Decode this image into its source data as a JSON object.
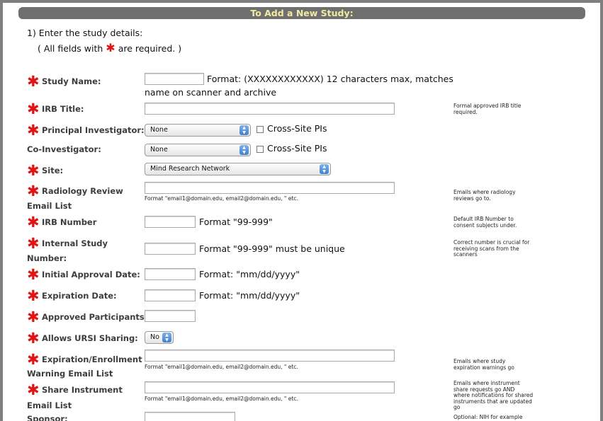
{
  "header": {
    "title": "To Add a New Study:"
  },
  "intro": {
    "line1": "1) Enter the study details:",
    "line2_pre": "( All fields with",
    "line2_post": "are required. )"
  },
  "required_marker": "✱",
  "fields": {
    "study_name": {
      "label": "Study Name:",
      "format": "Format: (XXXXXXXXXXXX) 12 characters max, matches",
      "format2": "name on scanner and archive"
    },
    "irb_title": {
      "label": "IRB Title:",
      "note": [
        "Formal approved IRB title",
        "required."
      ]
    },
    "pi": {
      "label": "Principal Investigator:",
      "value": "None",
      "cross_site": "Cross-Site PIs"
    },
    "co_investigator": {
      "label": "Co-Investigator:",
      "value": "None",
      "cross_site": "Cross-Site PIs"
    },
    "site": {
      "label": "Site:",
      "value": "Mind Research Network"
    },
    "radiology_email": {
      "label": "Radiology Review",
      "label2": "Email List",
      "hint": "Format \"email1@domain.edu, email2@domain.edu, \" etc.",
      "note": [
        "Emails where radiology",
        "reviews go to."
      ]
    },
    "irb_number": {
      "label": "IRB Number",
      "format": "Format \"99-999\"",
      "note": [
        "Default IRB Number to",
        "consent subjects under."
      ]
    },
    "internal_number": {
      "label": "Internal Study",
      "label2": "Number:",
      "format": "Format \"99-999\" must be unique",
      "note": [
        "Correct number is crucial for",
        "receiving scans from the",
        "scanners"
      ]
    },
    "initial_approval": {
      "label": "Initial Approval Date:",
      "format": "Format: \"mm/dd/yyyy\""
    },
    "expiration_date": {
      "label": "Expiration Date:",
      "format": "Format: \"mm/dd/yyyy\""
    },
    "approved_participants": {
      "label": "Approved Participants:"
    },
    "ursi_sharing": {
      "label": "Allows URSI Sharing:",
      "value": "No"
    },
    "expiration_email": {
      "label": "Expiration/Enrollment",
      "label2": "Warning Email List",
      "hint": "Format \"email1@domain.edu, email2@domain.edu, \" etc.",
      "note": [
        "Emails where study",
        "expiration warnings go"
      ]
    },
    "share_instrument": {
      "label": "Share Instrument",
      "label2": "Email List",
      "hint": "Format \"email1@domain.edu, email2@domain.edu, \" etc.",
      "note": [
        "Emails where instrument",
        "share requests go AND",
        "where notifications for shared",
        "instruments that are updated",
        "go"
      ]
    },
    "sponsor": {
      "label": "Sponsor:",
      "note": [
        "Optional: NIH for example"
      ]
    }
  },
  "colors": {
    "header_bg": "#6f6f6f",
    "header_text": "#f1eaa0",
    "required": "#e01414",
    "label": "#3d3d3d"
  }
}
